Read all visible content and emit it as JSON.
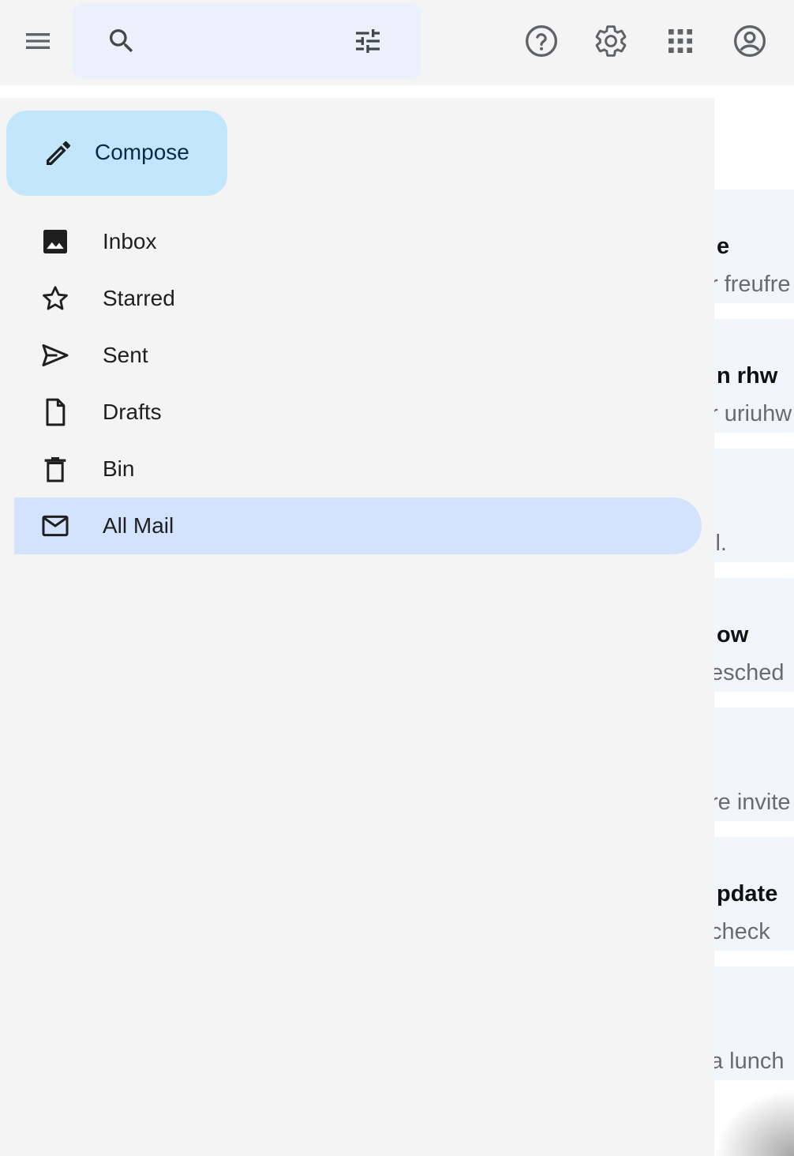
{
  "topbar": {
    "menu_icon": "hamburger-menu-icon",
    "search_placeholder": "",
    "search_icon": "search-icon",
    "filter_icon": "tune-icon",
    "help_icon": "help-circle-icon",
    "settings_icon": "gear-icon",
    "apps_icon": "apps-grid-icon",
    "account_icon": "account-circle-icon"
  },
  "drawer": {
    "compose_label": "Compose",
    "items": [
      {
        "label": "Inbox",
        "icon": "inbox-image-icon"
      },
      {
        "label": "Starred",
        "icon": "star-outline-icon"
      },
      {
        "label": "Sent",
        "icon": "send-icon"
      },
      {
        "label": "Drafts",
        "icon": "draft-file-icon"
      },
      {
        "label": "Bin",
        "icon": "trash-icon"
      },
      {
        "label": "All Mail",
        "icon": "mail-envelope-icon",
        "active": true
      }
    ]
  },
  "mail_list": [
    {
      "subject": "e",
      "snippet": "r freufre"
    },
    {
      "subject": "n rhw",
      "snippet": "r uriuhw"
    },
    {
      "subject": "",
      "snippet": "il."
    },
    {
      "subject": "ow",
      "snippet": "esched"
    },
    {
      "subject": "",
      "snippet": "re invite"
    },
    {
      "subject": "pdate",
      "snippet": " check"
    },
    {
      "subject": "",
      "snippet": " a lunch"
    }
  ],
  "colors": {
    "background": "#f4f4f4",
    "search_bg": "#eaf1fb",
    "compose_bg": "#c2e7fc",
    "active_nav_bg": "#d3e3fd",
    "mail_row_bg": "#f2f6fc"
  }
}
